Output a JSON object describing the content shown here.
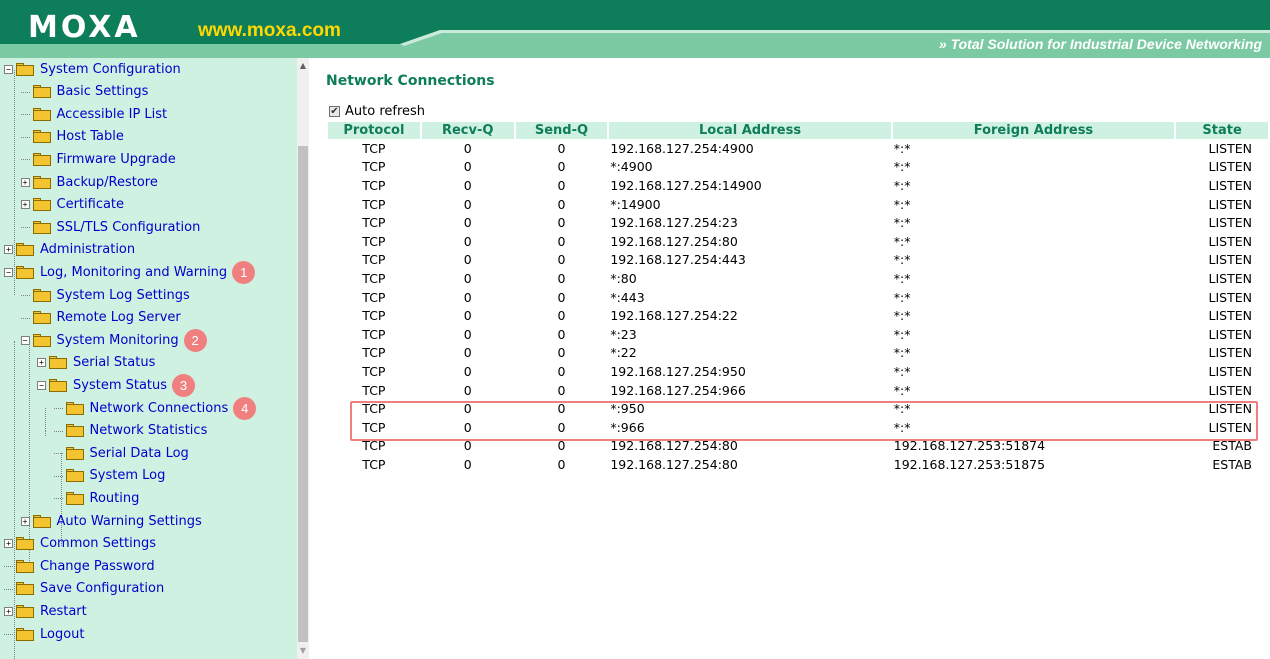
{
  "header": {
    "logo": "MOXA",
    "site": "www.moxa.com",
    "tagline": "Total Solution for Industrial Device Networking",
    "tagline_arrows": "»"
  },
  "sidebar": {
    "items": [
      {
        "label": "System Configuration",
        "expander": "−"
      },
      {
        "label": "Basic Settings"
      },
      {
        "label": "Accessible IP List"
      },
      {
        "label": "Host Table"
      },
      {
        "label": "Firmware Upgrade"
      },
      {
        "label": "Backup/Restore",
        "expander": "+"
      },
      {
        "label": "Certificate",
        "expander": "+"
      },
      {
        "label": "SSL/TLS Configuration"
      },
      {
        "label": "Administration",
        "expander": "+"
      },
      {
        "label": "Log, Monitoring and Warning",
        "expander": "−",
        "badge": "1"
      },
      {
        "label": "System Log Settings"
      },
      {
        "label": "Remote Log Server"
      },
      {
        "label": "System Monitoring",
        "expander": "−",
        "badge": "2"
      },
      {
        "label": "Serial Status",
        "expander": "+"
      },
      {
        "label": "System Status",
        "expander": "−",
        "badge": "3"
      },
      {
        "label": "Network Connections",
        "badge": "4"
      },
      {
        "label": "Network Statistics"
      },
      {
        "label": "Serial Data Log"
      },
      {
        "label": "System Log"
      },
      {
        "label": "Routing"
      },
      {
        "label": "Auto Warning Settings",
        "expander": "+"
      },
      {
        "label": "Common Settings",
        "expander": "+"
      },
      {
        "label": "Change Password"
      },
      {
        "label": "Save Configuration"
      },
      {
        "label": "Restart",
        "expander": "+"
      },
      {
        "label": "Logout"
      }
    ]
  },
  "main": {
    "title": "Network Connections",
    "auto_refresh_label": "Auto refresh",
    "auto_refresh_checked": true,
    "table": {
      "headers": [
        "Protocol",
        "Recv-Q",
        "Send-Q",
        "Local Address",
        "Foreign Address",
        "State"
      ],
      "rows": [
        [
          "TCP",
          "0",
          "0",
          "192.168.127.254:4900",
          "*:*",
          "LISTEN"
        ],
        [
          "TCP",
          "0",
          "0",
          "*:4900",
          "*:*",
          "LISTEN"
        ],
        [
          "TCP",
          "0",
          "0",
          "192.168.127.254:14900",
          "*:*",
          "LISTEN"
        ],
        [
          "TCP",
          "0",
          "0",
          "*:14900",
          "*:*",
          "LISTEN"
        ],
        [
          "TCP",
          "0",
          "0",
          "192.168.127.254:23",
          "*:*",
          "LISTEN"
        ],
        [
          "TCP",
          "0",
          "0",
          "192.168.127.254:80",
          "*:*",
          "LISTEN"
        ],
        [
          "TCP",
          "0",
          "0",
          "192.168.127.254:443",
          "*:*",
          "LISTEN"
        ],
        [
          "TCP",
          "0",
          "0",
          "*:80",
          "*:*",
          "LISTEN"
        ],
        [
          "TCP",
          "0",
          "0",
          "*:443",
          "*:*",
          "LISTEN"
        ],
        [
          "TCP",
          "0",
          "0",
          "192.168.127.254:22",
          "*:*",
          "LISTEN"
        ],
        [
          "TCP",
          "0",
          "0",
          "*:23",
          "*:*",
          "LISTEN"
        ],
        [
          "TCP",
          "0",
          "0",
          "*:22",
          "*:*",
          "LISTEN"
        ],
        [
          "TCP",
          "0",
          "0",
          "192.168.127.254:950",
          "*:*",
          "LISTEN"
        ],
        [
          "TCP",
          "0",
          "0",
          "192.168.127.254:966",
          "*:*",
          "LISTEN"
        ],
        [
          "TCP",
          "0",
          "0",
          "*:950",
          "*:*",
          "LISTEN"
        ],
        [
          "TCP",
          "0",
          "0",
          "*:966",
          "*:*",
          "LISTEN"
        ],
        [
          "TCP",
          "0",
          "0",
          "192.168.127.254:80",
          "192.168.127.253:51874",
          "ESTAB"
        ],
        [
          "TCP",
          "0",
          "0",
          "192.168.127.254:80",
          "192.168.127.253:51875",
          "ESTAB"
        ]
      ]
    }
  },
  "colors": {
    "header_green": "#0e7d5a",
    "header_light_green": "#7ccaa3",
    "sidebar_bg": "#cff1e1",
    "badge": "#f08080",
    "link": "#0000cc",
    "highlight_border": "#f08080"
  }
}
